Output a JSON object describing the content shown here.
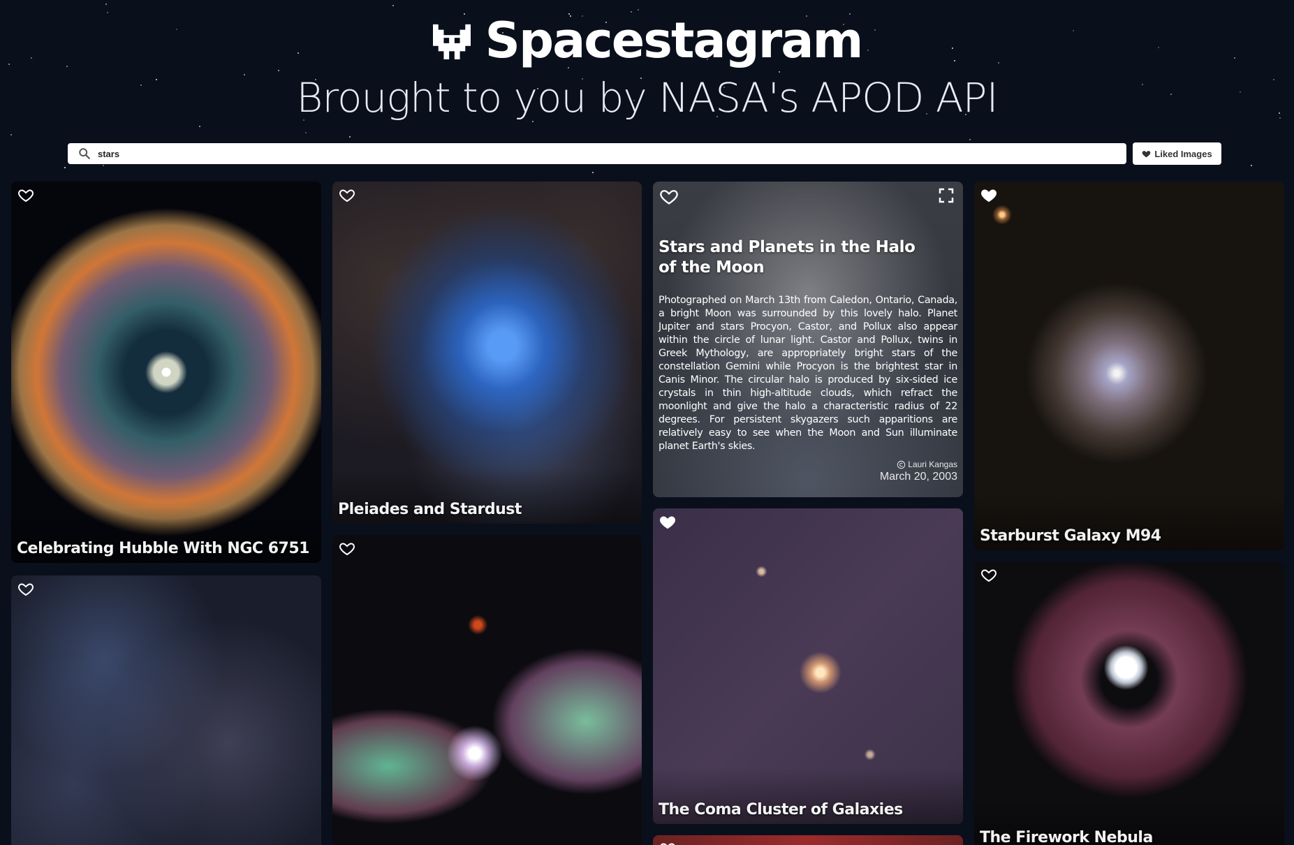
{
  "app": {
    "title": "Spacestagram",
    "subtitle": "Brought to you by NASA's APOD API"
  },
  "search": {
    "value": "stars"
  },
  "toolbar": {
    "liked_label": "Liked Images"
  },
  "cards": [
    {
      "title": "Celebrating Hubble With NGC 6751",
      "liked": false
    },
    {
      "title": "",
      "liked": false
    },
    {
      "title": "Pleiades and Stardust",
      "liked": false
    },
    {
      "title": "",
      "liked": false
    },
    {
      "title": "Stars and Planets in the Halo of the Moon",
      "liked": false,
      "explanation": "Photographed on March 13th from Caledon, Ontario, Canada, a bright Moon was surrounded by this lovely halo. Planet Jupiter and stars Procyon, Castor, and Pollux also appear within the circle of lunar light. Castor and Pollux, twins in Greek Mythology, are appropriately bright stars of the constellation Gemini while Procyon is the brightest star in Canis Minor. The circular halo is produced by six-sided ice crystals in thin high-altitude clouds, which refract the moonlight and give the halo a characteristic radius of 22 degrees. For persistent skygazers such apparitions are relatively easy to see when the Moon and Sun illuminate planet Earth's skies.",
      "copyright": "Lauri Kangas",
      "date": "March 20, 2003"
    },
    {
      "title": "The Coma Cluster of Galaxies",
      "liked": true
    },
    {
      "title": "",
      "liked": false
    },
    {
      "title": "Starburst Galaxy M94",
      "liked": true
    },
    {
      "title": "The Firework Nebula",
      "liked": false
    }
  ],
  "colors": {
    "background": "#0a0f1c",
    "card_bg": "#141924"
  },
  "icons": {
    "logo": "alien-monster-icon",
    "search": "search-icon",
    "heart": "heart-icon",
    "expand": "expand-icon",
    "copyright": "copyright-icon"
  }
}
